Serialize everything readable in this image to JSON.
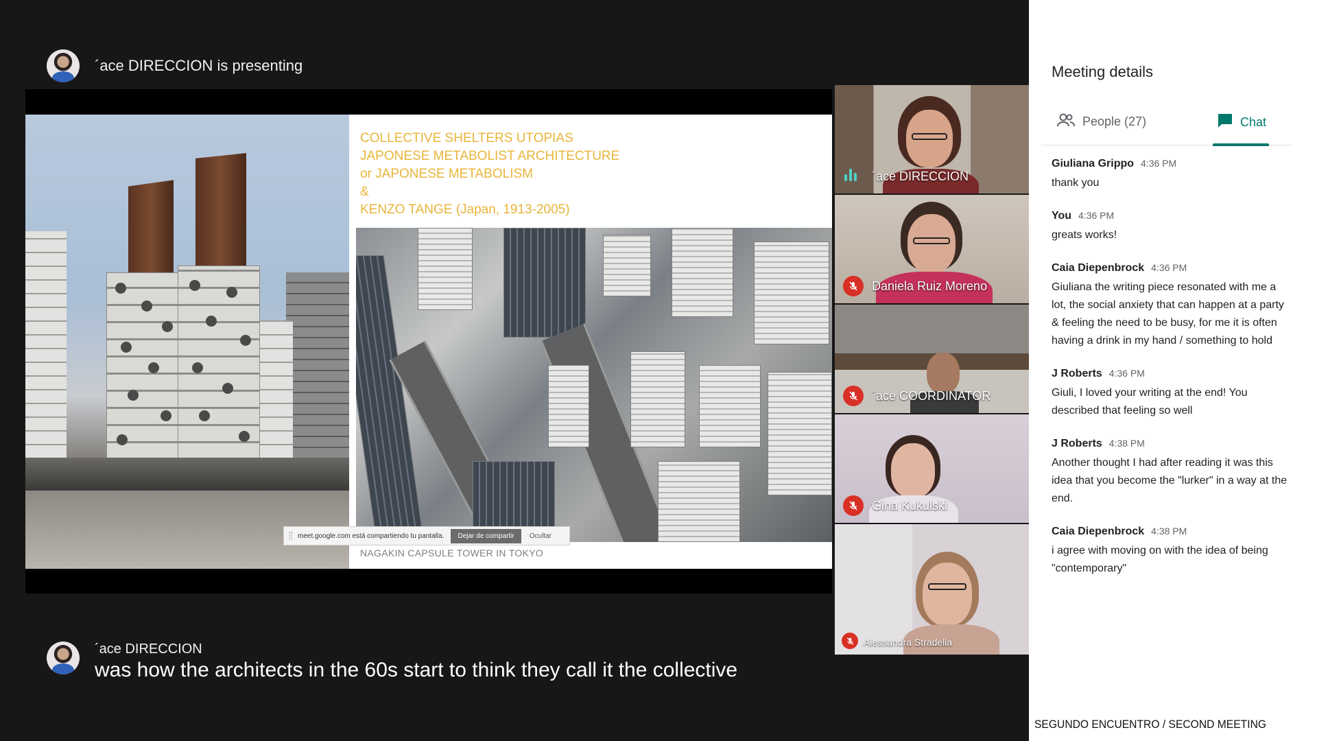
{
  "presenter": {
    "banner_text": "´ace DIRECCION is presenting"
  },
  "slide": {
    "title_lines": [
      "COLLECTIVE SHELTERS UTOPIAS",
      "JAPONESE METABOLIST ARCHITECTURE",
      "or JAPONESE METABOLISM",
      "&",
      "KENZO TANGE (Japan, 1913-2005)"
    ],
    "caption": "NAGAKIN CAPSULE TOWER IN TOKYO",
    "share_bar": {
      "message": "meet.google.com está compartiendo tu pantalla.",
      "stop_label": "Dejar de compartir",
      "hide_label": "Ocultar"
    }
  },
  "participants": [
    {
      "name": "´ace DIRECCION",
      "state": "speaking"
    },
    {
      "name": "Daniela Ruiz Moreno",
      "state": "muted"
    },
    {
      "name": "´ace COORDINATOR",
      "state": "muted"
    },
    {
      "name": "Gina Kukulski",
      "state": "muted"
    },
    {
      "name": "Alessandra Stradella",
      "state": "muted"
    }
  ],
  "captions": {
    "speaker": "´ace DIRECCION",
    "text": "was how the architects in the 60s start to think they call it the collective"
  },
  "panel": {
    "title": "Meeting details",
    "tabs": [
      {
        "label": "People (27)",
        "icon": "people-icon",
        "active": false
      },
      {
        "label": "Chat",
        "icon": "chat-icon",
        "active": true
      }
    ],
    "messages": [
      {
        "sender": "Giuliana Grippo",
        "time": "4:36 PM",
        "text": "thank you"
      },
      {
        "sender": "You",
        "time": "4:36 PM",
        "text": "greats works!"
      },
      {
        "sender": "Caia Diepenbrock",
        "time": "4:36 PM",
        "text": "Giuliana the writing piece resonated with me a lot, the social anxiety that can happen at a party & feeling the need to be busy, for me it is often having a drink in my hand / something to hold"
      },
      {
        "sender": "J Roberts",
        "time": "4:36 PM",
        "text": "Giuli, I loved your writing at the end! You described that feeling so well"
      },
      {
        "sender": "J Roberts",
        "time": "4:38 PM",
        "text": "Another thought I had after reading it was this idea that you become the \"lurker\" in a way at the end."
      },
      {
        "sender": "Caia Diepenbrock",
        "time": "4:38 PM",
        "text": "i agree with moving on with the idea of being \"contemporary\""
      }
    ]
  },
  "footer": {
    "label": "SEGUNDO ENCUENTRO / SECOND MEETING"
  },
  "colors": {
    "accent": "#00796b",
    "slide_title": "#e8b53a",
    "mic_off": "#d93025",
    "speaking": "#4fd1c5"
  }
}
